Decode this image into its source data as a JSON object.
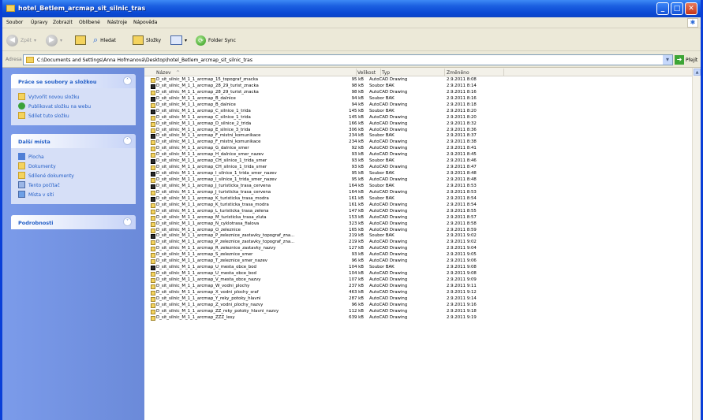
{
  "window": {
    "title": "hotel_Betlem_arcmap_sit_silnic_tras"
  },
  "menu": [
    "Soubor",
    "Úpravy",
    "Zobrazit",
    "Oblíbené",
    "Nástroje",
    "Nápověda"
  ],
  "toolbar": {
    "back": "Zpět",
    "search": "Hledat",
    "folders": "Složky",
    "sync": "Folder Sync"
  },
  "address": {
    "label": "Adresa",
    "value": "C:\\Documents and Settings\\Anna Hofmanová\\Desktop\\hotel_Betlem_arcmap_sit_silnic_tras",
    "go": "Přejít"
  },
  "tasks": {
    "panel1": {
      "title": "Práce se soubory a složkou",
      "items": [
        "Vytvořit novou složku",
        "Publikovat složku na webu",
        "Sdílet tuto složku"
      ]
    },
    "panel2": {
      "title": "Další místa",
      "items": [
        "Plocha",
        "Dokumenty",
        "Sdílené dokumenty",
        "Tento počítač",
        "Místa v síti"
      ]
    },
    "panel3": {
      "title": "Podrobnosti"
    }
  },
  "columns": {
    "name": "Název",
    "size": "Velikost",
    "type": "Typ",
    "modified": "Změněno"
  },
  "files": [
    {
      "name": "D_sit_silnic_M_1_1_arcmap_15_topograf_znacka",
      "size": "95 kB",
      "type": "AutoCAD Drawing",
      "date": "2.9.2011 8:08",
      "bak": false
    },
    {
      "name": "D_sit_silnic_M_1_1_arcmap_28_29_turist_znacka",
      "size": "98 kB",
      "type": "Soubor BAK",
      "date": "2.9.2011 8:14",
      "bak": true
    },
    {
      "name": "D_sit_silnic_M_1_1_arcmap_28_29_turist_znacka",
      "size": "98 kB",
      "type": "AutoCAD Drawing",
      "date": "2.9.2011 8:16",
      "bak": false
    },
    {
      "name": "D_sit_silnic_M_1_1_arcmap_B_dalnice",
      "size": "94 kB",
      "type": "Soubor BAK",
      "date": "2.9.2011 8:16",
      "bak": true
    },
    {
      "name": "D_sit_silnic_M_1_1_arcmap_B_dalnice",
      "size": "94 kB",
      "type": "AutoCAD Drawing",
      "date": "2.9.2011 8:18",
      "bak": false
    },
    {
      "name": "D_sit_silnic_M_1_1_arcmap_C_silnice_1_trida",
      "size": "145 kB",
      "type": "Soubor BAK",
      "date": "2.9.2011 8:20",
      "bak": true
    },
    {
      "name": "D_sit_silnic_M_1_1_arcmap_C_silnice_1_trida",
      "size": "145 kB",
      "type": "AutoCAD Drawing",
      "date": "2.9.2011 8:20",
      "bak": false
    },
    {
      "name": "D_sit_silnic_M_1_1_arcmap_D_silnice_2_trida",
      "size": "166 kB",
      "type": "AutoCAD Drawing",
      "date": "2.9.2011 8:32",
      "bak": false
    },
    {
      "name": "D_sit_silnic_M_1_1_arcmap_E_silnice_3_trida",
      "size": "306 kB",
      "type": "AutoCAD Drawing",
      "date": "2.9.2011 8:36",
      "bak": false
    },
    {
      "name": "D_sit_silnic_M_1_1_arcmap_F_mistni_komunikace",
      "size": "234 kB",
      "type": "Soubor BAK",
      "date": "2.9.2011 8:37",
      "bak": true
    },
    {
      "name": "D_sit_silnic_M_1_1_arcmap_F_mistni_komunikace",
      "size": "234 kB",
      "type": "AutoCAD Drawing",
      "date": "2.9.2011 8:38",
      "bak": false
    },
    {
      "name": "D_sit_silnic_M_1_1_arcmap_G_dalnice_smer",
      "size": "92 kB",
      "type": "AutoCAD Drawing",
      "date": "2.9.2011 8:41",
      "bak": false
    },
    {
      "name": "D_sit_silnic_M_1_1_arcmap_H_dalnice_smer_nazev",
      "size": "93 kB",
      "type": "AutoCAD Drawing",
      "date": "2.9.2011 8:45",
      "bak": false
    },
    {
      "name": "D_sit_silnic_M_1_1_arcmap_CH_silnice_1_trida_smer",
      "size": "93 kB",
      "type": "Soubor BAK",
      "date": "2.9.2011 8:46",
      "bak": true
    },
    {
      "name": "D_sit_silnic_M_1_1_arcmap_CH_silnice_1_trida_smer",
      "size": "93 kB",
      "type": "AutoCAD Drawing",
      "date": "2.9.2011 8:47",
      "bak": false
    },
    {
      "name": "D_sit_silnic_M_1_1_arcmap_I_silnice_1_trida_smer_nazev",
      "size": "95 kB",
      "type": "Soubor BAK",
      "date": "2.9.2011 8:48",
      "bak": true
    },
    {
      "name": "D_sit_silnic_M_1_1_arcmap_I_silnice_1_trida_smer_nazev",
      "size": "95 kB",
      "type": "AutoCAD Drawing",
      "date": "2.9.2011 8:48",
      "bak": false
    },
    {
      "name": "D_sit_silnic_M_1_1_arcmap_J_turisticka_trasa_cervena",
      "size": "164 kB",
      "type": "Soubor BAK",
      "date": "2.9.2011 8:53",
      "bak": true
    },
    {
      "name": "D_sit_silnic_M_1_1_arcmap_J_turisticka_trasa_cervena",
      "size": "164 kB",
      "type": "AutoCAD Drawing",
      "date": "2.9.2011 8:53",
      "bak": false
    },
    {
      "name": "D_sit_silnic_M_1_1_arcmap_K_turisticka_trasa_modra",
      "size": "161 kB",
      "type": "Soubor BAK",
      "date": "2.9.2011 8:54",
      "bak": true
    },
    {
      "name": "D_sit_silnic_M_1_1_arcmap_K_turisticka_trasa_modra",
      "size": "161 kB",
      "type": "AutoCAD Drawing",
      "date": "2.9.2011 8:54",
      "bak": false
    },
    {
      "name": "D_sit_silnic_M_1_1_arcmap_L_turisticka_trasa_zelena",
      "size": "147 kB",
      "type": "AutoCAD Drawing",
      "date": "2.9.2011 8:55",
      "bak": false
    },
    {
      "name": "D_sit_silnic_M_1_1_arcmap_M_turisticka_trasa_zluta",
      "size": "153 kB",
      "type": "AutoCAD Drawing",
      "date": "2.9.2011 8:57",
      "bak": false
    },
    {
      "name": "D_sit_silnic_M_1_1_arcmap_N_cyklotrasa_fialova",
      "size": "323 kB",
      "type": "AutoCAD Drawing",
      "date": "2.9.2011 8:58",
      "bak": false
    },
    {
      "name": "D_sit_silnic_M_1_1_arcmap_O_zeleznice",
      "size": "165 kB",
      "type": "AutoCAD Drawing",
      "date": "2.9.2011 8:59",
      "bak": false
    },
    {
      "name": "D_sit_silnic_M_1_1_arcmap_P_zeleznice_zastavky_topograf_zna...",
      "size": "219 kB",
      "type": "Soubor BAK",
      "date": "2.9.2011 9:02",
      "bak": true
    },
    {
      "name": "D_sit_silnic_M_1_1_arcmap_P_zeleznice_zastavky_topograf_zna...",
      "size": "219 kB",
      "type": "AutoCAD Drawing",
      "date": "2.9.2011 9:02",
      "bak": false
    },
    {
      "name": "D_sit_silnic_M_1_1_arcmap_R_zeleznice_zastavky_nazvy",
      "size": "127 kB",
      "type": "AutoCAD Drawing",
      "date": "2.9.2011 9:04",
      "bak": false
    },
    {
      "name": "D_sit_silnic_M_1_1_arcmap_S_zeleznice_smer",
      "size": "93 kB",
      "type": "AutoCAD Drawing",
      "date": "2.9.2011 9:05",
      "bak": false
    },
    {
      "name": "D_sit_silnic_M_1_1_arcmap_T_zeleznice_smer_nazev",
      "size": "96 kB",
      "type": "AutoCAD Drawing",
      "date": "2.9.2011 9:06",
      "bak": false
    },
    {
      "name": "D_sit_silnic_M_1_1_arcmap_U_mesta_obce_bod",
      "size": "104 kB",
      "type": "Soubor BAK",
      "date": "2.9.2011 9:08",
      "bak": true
    },
    {
      "name": "D_sit_silnic_M_1_1_arcmap_U_mesta_obce_bod",
      "size": "104 kB",
      "type": "AutoCAD Drawing",
      "date": "2.9.2011 9:08",
      "bak": false
    },
    {
      "name": "D_sit_silnic_M_1_1_arcmap_V_mesta_obce_nazvy",
      "size": "107 kB",
      "type": "AutoCAD Drawing",
      "date": "2.9.2011 9:09",
      "bak": false
    },
    {
      "name": "D_sit_silnic_M_1_1_arcmap_W_vodni_plochy",
      "size": "237 kB",
      "type": "AutoCAD Drawing",
      "date": "2.9.2011 9:11",
      "bak": false
    },
    {
      "name": "D_sit_silnic_M_1_1_arcmap_X_vodni_plochy_sraf",
      "size": "463 kB",
      "type": "AutoCAD Drawing",
      "date": "2.9.2011 9:12",
      "bak": false
    },
    {
      "name": "D_sit_silnic_M_1_1_arcmap_Y_reky_potoky_hlavni",
      "size": "287 kB",
      "type": "AutoCAD Drawing",
      "date": "2.9.2011 9:14",
      "bak": false
    },
    {
      "name": "D_sit_silnic_M_1_1_arcmap_Z_vodni_plochy_nazvy",
      "size": "96 kB",
      "type": "AutoCAD Drawing",
      "date": "2.9.2011 9:16",
      "bak": false
    },
    {
      "name": "D_sit_silnic_M_1_1_arcmap_ZZ_reky_potoky_hlavni_nazvy",
      "size": "112 kB",
      "type": "AutoCAD Drawing",
      "date": "2.9.2011 9:18",
      "bak": false
    },
    {
      "name": "D_sit_silnic_M_1_1_arcmap_ZZZ_lesy",
      "size": "639 kB",
      "type": "AutoCAD Drawing",
      "date": "2.9.2011 9:19",
      "bak": false
    }
  ]
}
